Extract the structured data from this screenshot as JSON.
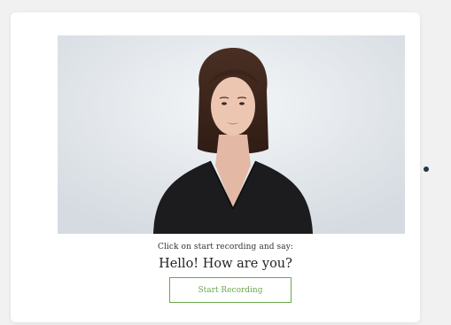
{
  "prompt": {
    "instruction": "Click on start recording and say:",
    "phrase": "Hello! How are you?"
  },
  "controls": {
    "start_recording_label": "Start Recording"
  },
  "colors": {
    "accent_green": "#6aa84f",
    "indicator_dot": "#1f3a4d",
    "video_background": "#e6eaee"
  },
  "icons": {
    "indicator": "dot-icon"
  }
}
